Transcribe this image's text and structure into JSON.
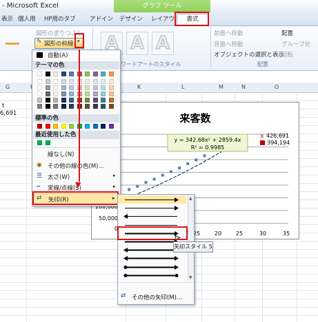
{
  "window": {
    "title": "- Microsoft Excel",
    "contextual_group": "グラフ ツール"
  },
  "tabs": [
    "表示",
    "個人用",
    "HP用のタブ",
    "アドイン",
    "デザイン",
    "レイアウト",
    "書式"
  ],
  "ribbon": {
    "shape_fill": "図形の塗りつぶし",
    "shape_outline": "図形の枠線",
    "wordart_group": "ワードアートのスタイル",
    "bring_forward": "前面へ移動",
    "send_backward": "背面へ移動",
    "selection_pane": "オブジェクトの選択と表示",
    "align": "配置",
    "group": "グループ化",
    "rotate": "回転",
    "arrange_group": "配置"
  },
  "sheet": {
    "columns": [
      "G",
      "H",
      "K",
      "L",
      "M",
      "N",
      "O"
    ],
    "cells": [
      "t",
      "6,691"
    ]
  },
  "chart": {
    "title": "来客数",
    "trendline_equation": "y = 342.68x² + 2859.4x",
    "r_squared": "R² = 0.9985",
    "label_1": "426,691",
    "label_2": "394,194",
    "y_ticks": [
      "100,000",
      "50,000",
      "0"
    ],
    "x_ticks": [
      "25",
      "20",
      "25",
      "30",
      "35"
    ]
  },
  "chart_data": {
    "type": "scatter",
    "title": "来客数",
    "series": [
      {
        "name": "",
        "x": [
          16,
          17,
          18,
          19,
          20,
          21,
          22,
          23,
          24,
          25,
          29
        ],
        "y": [
          166000,
          180000,
          196000,
          210000,
          227000,
          242000,
          258000,
          276000,
          292000,
          310000,
          394194
        ]
      }
    ],
    "trendline": {
      "equation": "y = 342.68x² + 2859.4x",
      "r2": "0.9985"
    },
    "markers": [
      {
        "x": 29,
        "y": 426691,
        "label": "426,691",
        "shape": "x"
      },
      {
        "x": 29,
        "y": 394194,
        "label": "394,194",
        "shape": "square"
      }
    ],
    "xlim": [
      15,
      35
    ],
    "x_ticks": [
      "25",
      "20",
      "25",
      "30",
      "35"
    ],
    "y_ticks": [
      "100,000",
      "50,000",
      "0"
    ],
    "grid": true
  },
  "dropdown": {
    "auto": "自動(A)",
    "theme_colors": "テーマの色",
    "standard_colors": "標準の色",
    "recent_colors": "最近使用した色",
    "no_line": "線なし(N)",
    "more_colors": "その他の線の色(M)...",
    "weight": "太さ(W)",
    "dashes": "実線/点線(S)",
    "arrows": "矢印(R)",
    "theme_palette": [
      "#ffffff",
      "#000000",
      "#eeece1",
      "#1f497d",
      "#4f81bd",
      "#c0504d",
      "#9bbb59",
      "#8064a2",
      "#4bacc6",
      "#f79646"
    ],
    "standard_palette": [
      "#c00000",
      "#ff0000",
      "#ffc000",
      "#ffff00",
      "#92d050",
      "#00b050",
      "#00b0f0",
      "#0070c0",
      "#002060",
      "#7030a0"
    ],
    "recent_palette": [
      "#00b050",
      "#00b050"
    ]
  },
  "arrows_menu": {
    "tooltip": "矢印スタイル 5",
    "more": "その他の矢印(M)..."
  },
  "colors": {
    "highlight": "#e01010",
    "accent": "#2b579a",
    "hover": "#ffe8a6"
  }
}
